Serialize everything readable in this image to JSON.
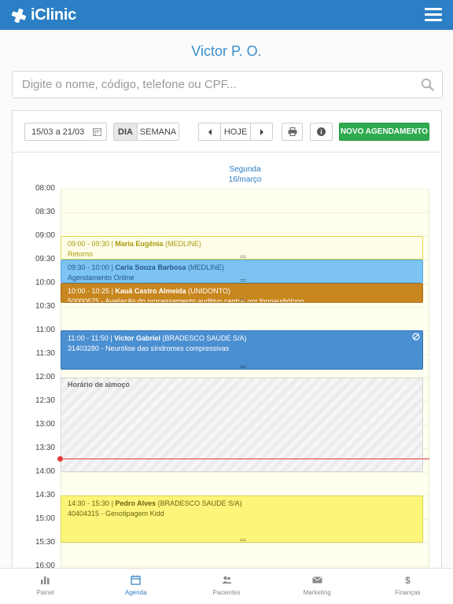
{
  "app": {
    "name": "iClinic"
  },
  "doctor": {
    "name": "Victor P. O."
  },
  "search": {
    "placeholder": "Digite o nome, código, telefone ou CPF..."
  },
  "toolbar": {
    "date_range": "15/03 a 21/03",
    "view_day": "DIA",
    "view_week": "SEMANA",
    "today": "HOJE",
    "new_appointment": "NOVO AGENDAMENTO"
  },
  "day": {
    "weekday": "Segunda",
    "date": "16/março"
  },
  "times": [
    "08:00",
    "08:30",
    "09:00",
    "09:30",
    "10:00",
    "10:30",
    "11:00",
    "11:30",
    "12:00",
    "12:30",
    "13:00",
    "13:30",
    "14:00",
    "14:30",
    "15:00",
    "15:30",
    "16:00"
  ],
  "appointments": [
    {
      "time": "09:00 - 09:30",
      "sep": "|",
      "patient": "Maria Eugênia",
      "insurance": "(MEDLINE)",
      "detail": "Retorno",
      "bg": "#fffde6",
      "border": "#e3d64a",
      "color": "#a89a10"
    },
    {
      "time": "09:30 - 10:00",
      "sep": "|",
      "patient": "Carla Souza Barbosa",
      "insurance": "(MEDLINE)",
      "detail": "Agendamento Online",
      "bg": "#7cc3f2",
      "border": "#5aa9de",
      "color": "#24598a"
    },
    {
      "time": "10:00 - 10:25",
      "sep": "|",
      "patient": "Kauã Castro Almeida",
      "insurance": "(UNIDONTO)",
      "detail": "50000675 - Avaliação do processamento auditivo central por fonoaudiólogo",
      "bg": "#c8861e",
      "border": "#a86c12",
      "color": "#ffffff"
    },
    {
      "time": "11:00 - 11:50",
      "sep": "|",
      "patient": "Victor Gabriel",
      "insurance": "(BRADESCO SAUDE S/A)",
      "detail": "31403280 - Neurólise das síndromes compressivas",
      "bg": "#4a8fd1",
      "border": "#3274b4",
      "color": "#ffffff"
    },
    {
      "time": "14:30 - 15:30",
      "sep": "|",
      "patient": "Pedro Alves",
      "insurance": "(BRADESCO SAUDE S/A)",
      "detail": "40404315 - Genotipagem Kidd",
      "bg": "#fbf57a",
      "border": "#ddd44a",
      "color": "#6a6410"
    }
  ],
  "lunch": {
    "label": "Horário de almoço"
  },
  "tabs": [
    {
      "label": "Painel",
      "icon": "bar-chart-icon",
      "active": false
    },
    {
      "label": "Agenda",
      "icon": "calendar-icon",
      "active": true
    },
    {
      "label": "Pacientes",
      "icon": "users-icon",
      "active": false
    },
    {
      "label": "Marketing",
      "icon": "envelope-icon",
      "active": false
    },
    {
      "label": "Finanças",
      "icon": "dollar-icon",
      "active": false
    }
  ],
  "colors": {
    "brand": "#2c7fc4",
    "accent_green": "#2eaa4f",
    "now_line": "#e23a3a"
  }
}
